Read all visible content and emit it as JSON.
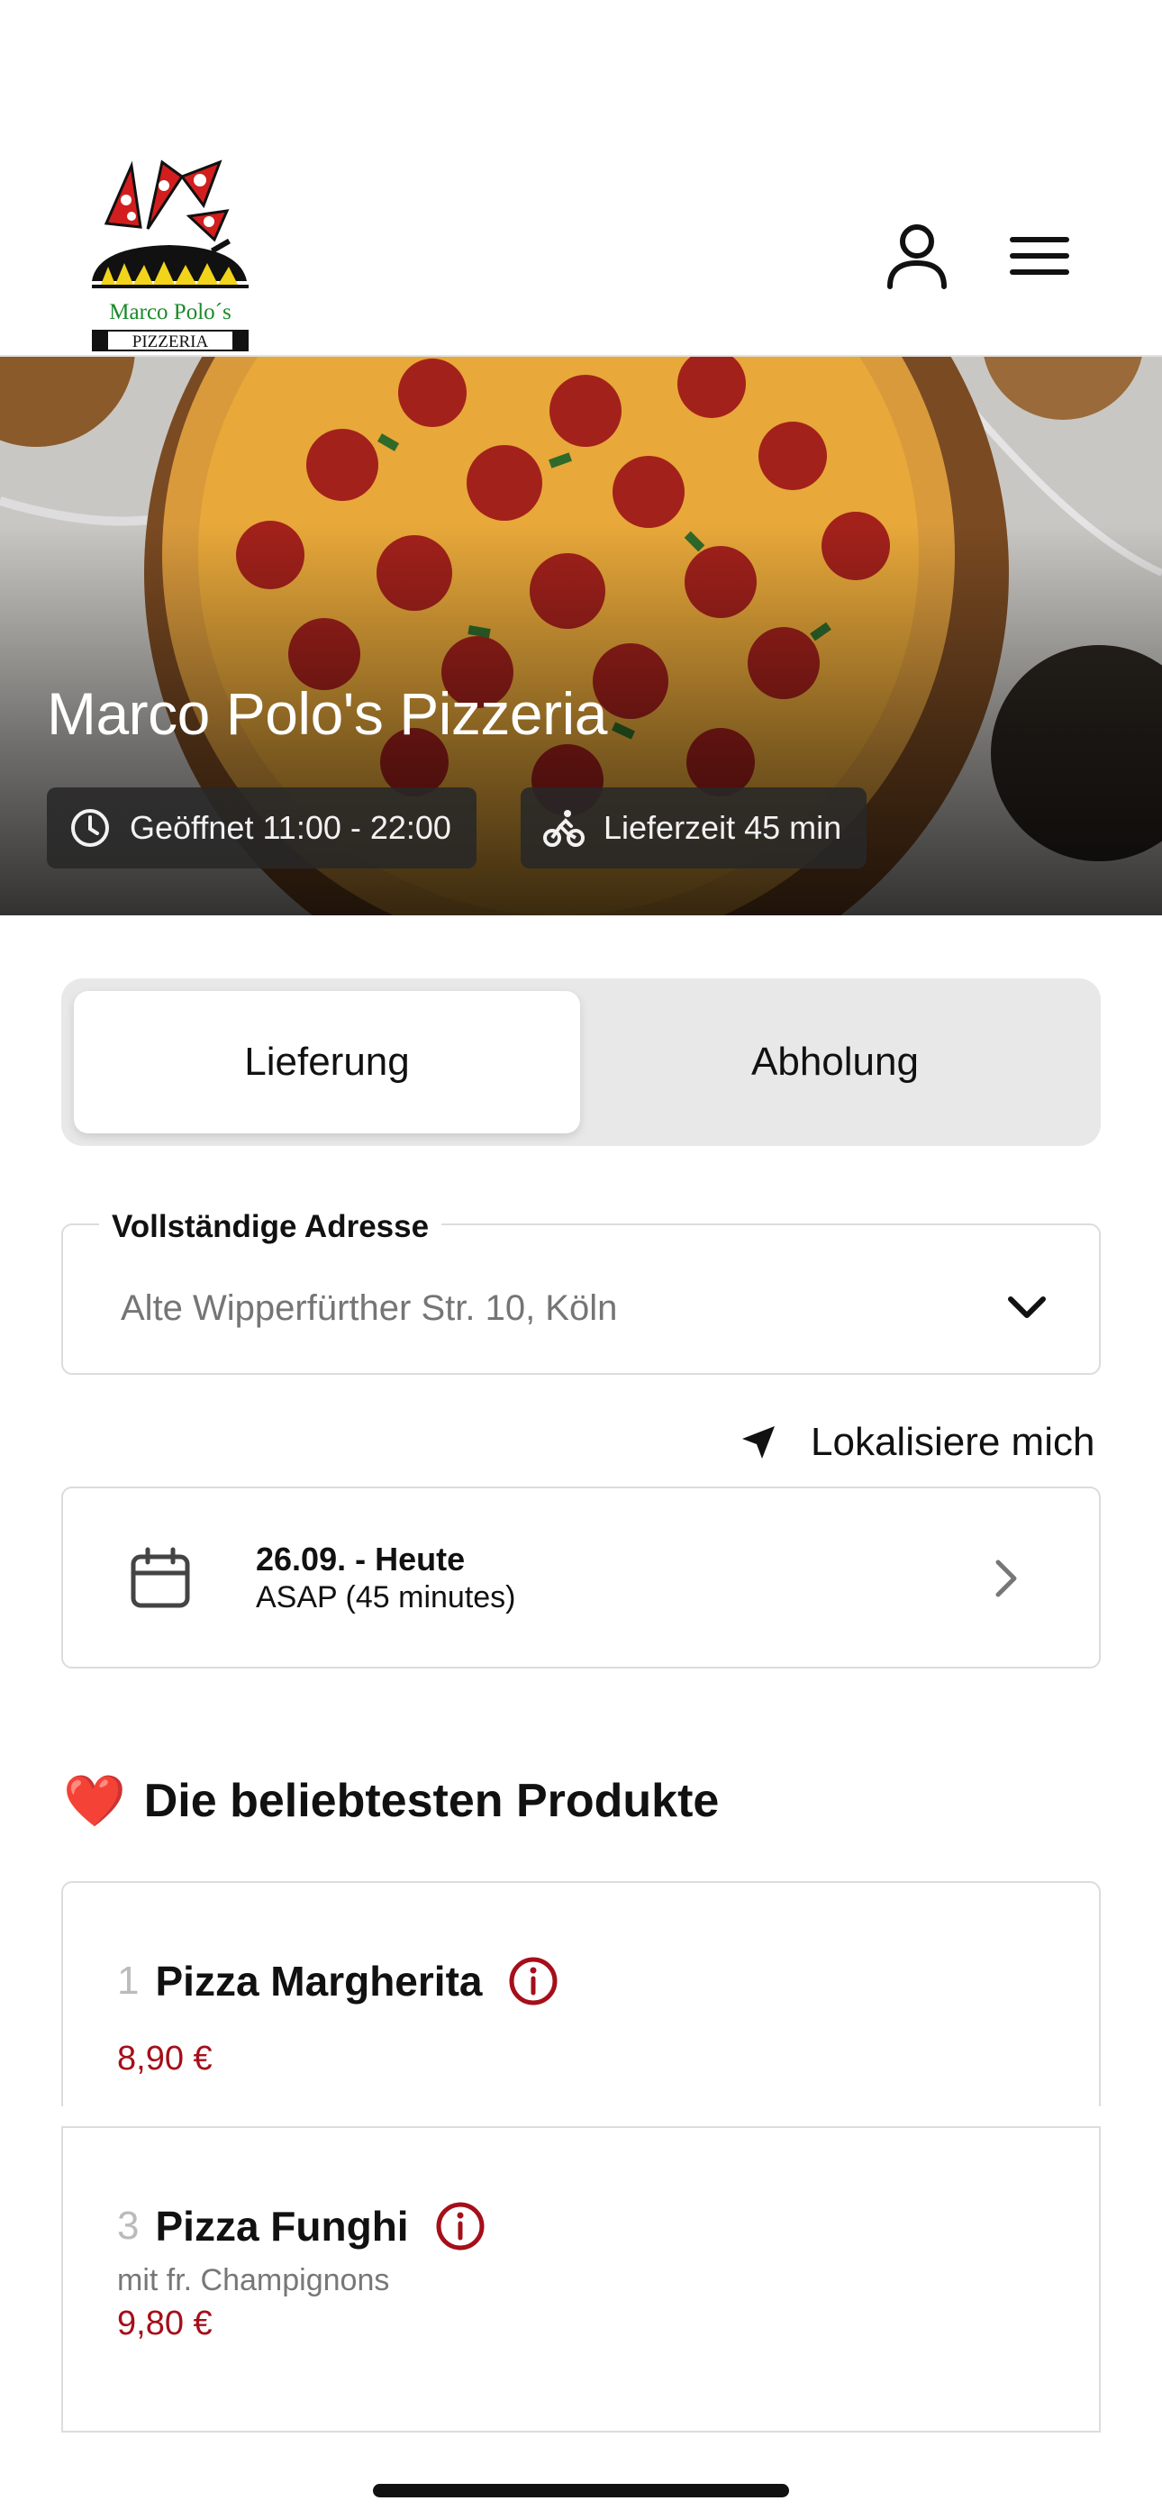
{
  "header": {
    "logo_text": "Marco Polo´s",
    "logo_subtext": "PIZZERIA"
  },
  "hero": {
    "title": "Marco Polo's Pizzeria",
    "hours": "Geöffnet 11:00 - 22:00",
    "delivery_time": "Lieferzeit 45 min"
  },
  "order_mode": {
    "active": "Lieferung",
    "inactive": "Abholung"
  },
  "address": {
    "label": "Vollständige Adresse",
    "placeholder": "Alte Wipperfürther Str. 10, Köln"
  },
  "locate_label": "Lokalisiere mich",
  "date": {
    "line1": "26.09. - Heute",
    "line2": "ASAP (45 minutes)"
  },
  "section": {
    "emoji": "❤️",
    "title": "Die beliebtesten Produkte"
  },
  "products": [
    {
      "number": "1",
      "name": "Pizza Margherita",
      "description": "",
      "price": "8,90 €"
    },
    {
      "number": "3",
      "name": "Pizza Funghi",
      "description": "mit fr. Champignons",
      "price": "9,80 €"
    }
  ],
  "colors": {
    "accent": "#a50f1a",
    "chip_bg": "#282828",
    "segment_bg": "#e8e8e8"
  },
  "icons": {
    "user": "user-icon",
    "menu": "hamburger-menu-icon",
    "clock": "clock-icon",
    "bike": "bicycle-icon",
    "chevron_down": "chevron-down-icon",
    "locate": "location-arrow-icon",
    "calendar": "calendar-icon",
    "chevron_right": "chevron-right-icon",
    "info": "info-icon"
  }
}
